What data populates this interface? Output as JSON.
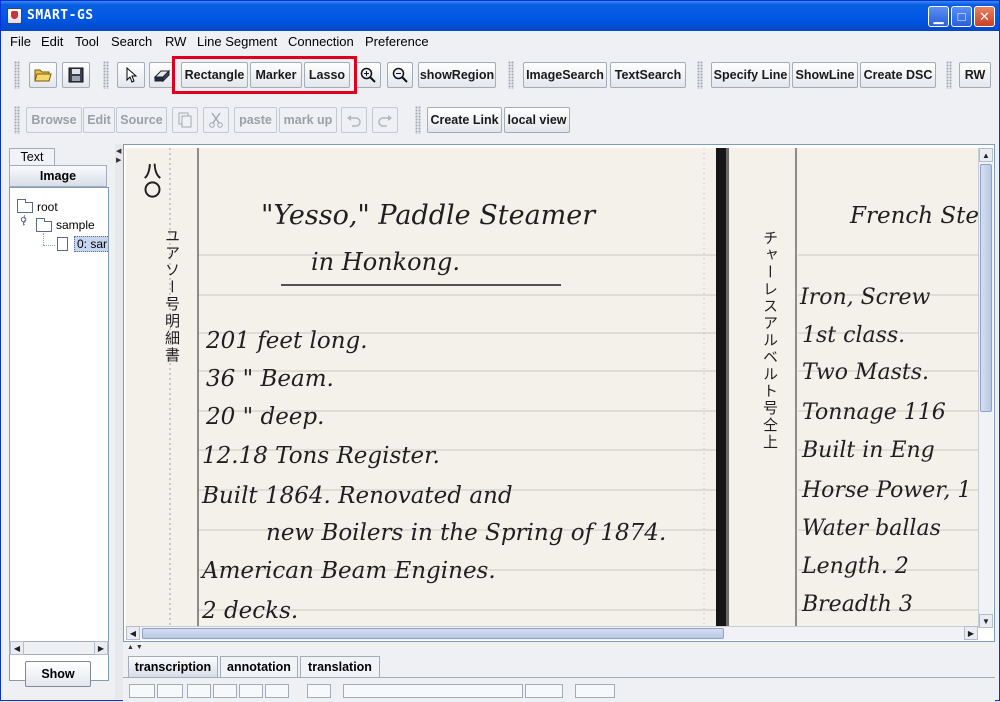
{
  "window": {
    "title": "SMART-GS",
    "minimize_glyph": "▁",
    "maximize_glyph": "□",
    "close_glyph": "✕"
  },
  "menubar": [
    "File",
    "Edit",
    "Tool",
    "Search",
    "RW",
    "Line Segment",
    "Connection",
    "Preference"
  ],
  "toolbar1": {
    "open_icon": "folder-open-icon",
    "save_icon": "floppy-save-icon",
    "pointer_icon": "arrow-pointer-icon",
    "eraser_icon": "eraser-icon",
    "rectangle": "Rectangle",
    "marker": "Marker",
    "lasso": "Lasso",
    "zoom_in_icon": "zoom-in-icon",
    "zoom_out_icon": "zoom-out-icon",
    "show_region": "showRegion",
    "image_search": "ImageSearch",
    "text_search": "TextSearch",
    "specify_line": "Specify Line",
    "show_line": "ShowLine",
    "create_dsc": "Create DSC",
    "rw": "RW"
  },
  "toolbar2": {
    "browse": "Browse",
    "edit": "Edit",
    "source": "Source",
    "copy_icon": "copy-icon",
    "cut_icon": "scissors-icon",
    "paste": "paste",
    "mark_up": "mark up",
    "undo_icon": "undo-icon",
    "redo_icon": "redo-icon",
    "create_link": "Create Link",
    "local_view": "local view"
  },
  "left_panel": {
    "tabs": [
      "Text",
      "Image"
    ],
    "active_tab": "Image",
    "tree": {
      "root": "root",
      "folder": "sample",
      "file": "0: sar"
    },
    "show_button": "Show"
  },
  "bottom_tabs": [
    "transcription",
    "annotation",
    "translation"
  ],
  "document": {
    "page_number": "八〇",
    "left_vertical": "ユアソー号明細書",
    "right_vertical": "チャーレスアルベルト号仝上",
    "left_lines": [
      "\"Yesso,\" Paddle Steamer",
      "in Honkong.",
      "201  feet long.",
      "36    \"  Beam.",
      "20    \"   deep.",
      "12.18  Tons Register.",
      "Built 1864.      Renovated and",
      "new Boilers in the Spring of 1874.",
      "American Beam Engines.",
      "2  decks."
    ],
    "right_lines": [
      "French Ste",
      "Iron, Screw",
      "1st class.",
      "Two Masts.",
      "Tonnage 116",
      "Built in Eng",
      "Horse Power, 1",
      "Water ballas",
      "Length.  2",
      "Breadth   3"
    ]
  }
}
